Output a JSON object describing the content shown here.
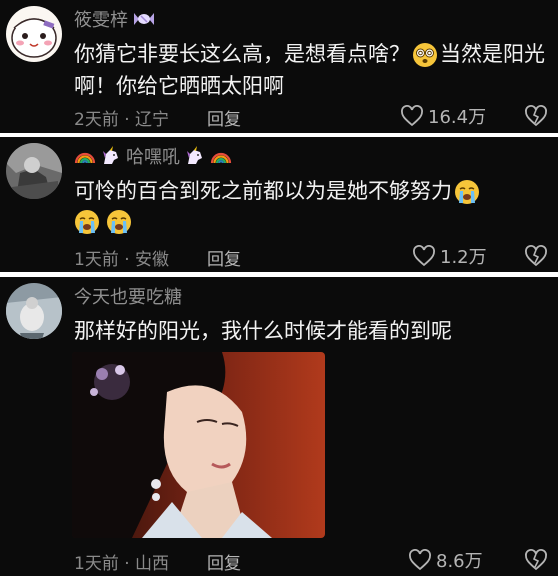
{
  "comments": [
    {
      "username": "筱雯梓",
      "text_part1": "你猜它非要长这么高，是想看点啥？",
      "text_part2": "当然是阳光啊！你给它晒晒太阳啊",
      "time": "2天前",
      "location": "辽宁",
      "reply_label": "回复",
      "likes": "16.4万"
    },
    {
      "username": "哈嘿吼",
      "text": "可怜的百合到死之前都以为是她不够努力",
      "time": "1天前",
      "location": "安徽",
      "reply_label": "回复",
      "likes": "1.2万"
    },
    {
      "username": "今天也要吃糖",
      "text": "那样好的阳光，我什么时候才能看的到呢",
      "time": "1天前",
      "location": "山西",
      "reply_label": "回复",
      "likes": "8.6万"
    }
  ],
  "separator": " · ",
  "icons": {
    "like": "heart-outline-icon",
    "dislike": "broken-heart-outline-icon",
    "candy": "candy-icon",
    "rainbow": "rainbow-emoji-icon",
    "unicorn": "unicorn-emoji-icon",
    "dizzy": "dizzy-face-emoji-icon",
    "crying": "loudly-crying-face-emoji-icon"
  },
  "colors": {
    "panel_bg": "#0b0b0b",
    "divider": "#ffffff",
    "username": "#8f8f8f",
    "text": "#f2f2f2",
    "meta": "#8a8a8a"
  }
}
